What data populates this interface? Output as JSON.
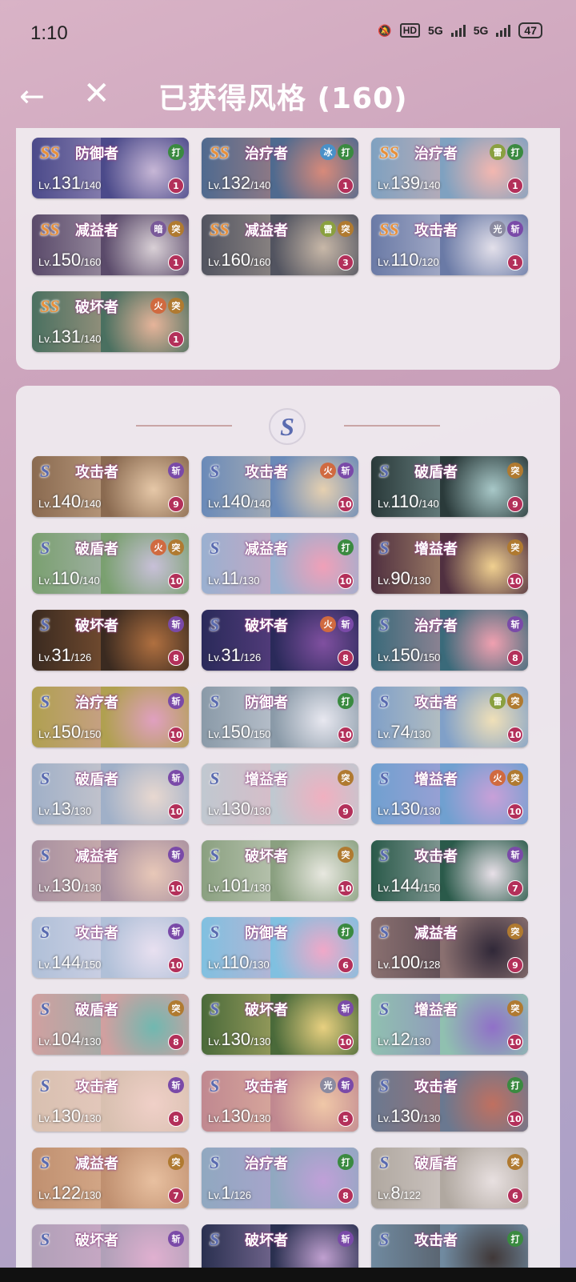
{
  "status": {
    "time": "1:10",
    "hd": "HD",
    "net1": "5G",
    "net2": "5G",
    "battery": "47"
  },
  "header": {
    "title": "已获得风格 (160)"
  },
  "sections": [
    {
      "rank": "SS",
      "cards": [
        {
          "rank": "SS",
          "role": "防御者",
          "el": "",
          "type": "打",
          "lv": "131",
          "max": "140",
          "count": "1",
          "c1": "#4b4a8a",
          "c2": "#c7b7d6"
        },
        {
          "rank": "SS",
          "role": "治疗者",
          "el": "冰",
          "type": "打",
          "lv": "132",
          "max": "140",
          "count": "1",
          "c1": "#4f6a8f",
          "c2": "#d88a7a"
        },
        {
          "rank": "SS",
          "role": "治疗者",
          "el": "雷",
          "type": "打",
          "lv": "139",
          "max": "140",
          "count": "1",
          "c1": "#7fa1c0",
          "c2": "#f3b7b0"
        },
        {
          "rank": "SS",
          "role": "减益者",
          "el": "暗",
          "type": "突",
          "lv": "150",
          "max": "160",
          "count": "1",
          "c1": "#5a4a6a",
          "c2": "#d9d0d6"
        },
        {
          "rank": "SS",
          "role": "减益者",
          "el": "雷",
          "type": "突",
          "lv": "160",
          "max": "160",
          "count": "3",
          "c1": "#525460",
          "c2": "#c8b8a8"
        },
        {
          "rank": "SS",
          "role": "攻击者",
          "el": "光",
          "type": "斩",
          "lv": "110",
          "max": "120",
          "count": "1",
          "c1": "#6a7aa6",
          "c2": "#e3e0ea"
        },
        {
          "rank": "SS",
          "role": "破坏者",
          "el": "火",
          "type": "突",
          "lv": "131",
          "max": "140",
          "count": "1",
          "c1": "#4a7060",
          "c2": "#e6b49a"
        }
      ]
    },
    {
      "rank": "S",
      "cards": [
        {
          "rank": "S",
          "role": "攻击者",
          "el": "",
          "type": "斩",
          "lv": "140",
          "max": "140",
          "count": "9",
          "c1": "#8a6a50",
          "c2": "#e6c8a8"
        },
        {
          "rank": "S",
          "role": "攻击者",
          "el": "火",
          "type": "斩",
          "lv": "140",
          "max": "140",
          "count": "10",
          "c1": "#6a8ab8",
          "c2": "#e6d0b0"
        },
        {
          "rank": "S",
          "role": "破盾者",
          "el": "",
          "type": "突",
          "lv": "110",
          "max": "140",
          "count": "9",
          "c1": "#2a3a3a",
          "c2": "#a8c8c8"
        },
        {
          "rank": "S",
          "role": "破盾者",
          "el": "火",
          "type": "突",
          "lv": "110",
          "max": "140",
          "count": "10",
          "c1": "#7aa070",
          "c2": "#c8c0d8"
        },
        {
          "rank": "S",
          "role": "减益者",
          "el": "",
          "type": "打",
          "lv": "11",
          "max": "130",
          "count": "10",
          "c1": "#9ab0d0",
          "c2": "#f0a0b8"
        },
        {
          "rank": "S",
          "role": "增益者",
          "el": "",
          "type": "突",
          "lv": "90",
          "max": "130",
          "count": "10",
          "c1": "#503040",
          "c2": "#f0d090"
        },
        {
          "rank": "S",
          "role": "破坏者",
          "el": "",
          "type": "斩",
          "lv": "31",
          "max": "126",
          "count": "8",
          "c1": "#3a2a20",
          "c2": "#b07040"
        },
        {
          "rank": "S",
          "role": "破坏者",
          "el": "火",
          "type": "斩",
          "lv": "31",
          "max": "126",
          "count": "8",
          "c1": "#2a2a5a",
          "c2": "#8050a0"
        },
        {
          "rank": "S",
          "role": "治疗者",
          "el": "",
          "type": "斩",
          "lv": "150",
          "max": "150",
          "count": "8",
          "c1": "#3a6a7a",
          "c2": "#f0a0b0"
        },
        {
          "rank": "S",
          "role": "治疗者",
          "el": "",
          "type": "斩",
          "lv": "150",
          "max": "150",
          "count": "10",
          "c1": "#b0a050",
          "c2": "#e0a0c0"
        },
        {
          "rank": "S",
          "role": "防御者",
          "el": "",
          "type": "打",
          "lv": "150",
          "max": "150",
          "count": "10",
          "c1": "#8a9aa8",
          "c2": "#e8e8f0"
        },
        {
          "rank": "S",
          "role": "攻击者",
          "el": "雷",
          "type": "突",
          "lv": "74",
          "max": "130",
          "count": "10",
          "c1": "#80a0c8",
          "c2": "#f0e0b8"
        },
        {
          "rank": "S",
          "role": "破盾者",
          "el": "",
          "type": "斩",
          "lv": "13",
          "max": "130",
          "count": "10",
          "c1": "#a0b0c8",
          "c2": "#e8d8d0"
        },
        {
          "rank": "S",
          "role": "增益者",
          "el": "",
          "type": "突",
          "lv": "130",
          "max": "130",
          "count": "9",
          "c1": "#c0c8d0",
          "c2": "#f0b0c0"
        },
        {
          "rank": "S",
          "role": "增益者",
          "el": "火",
          "type": "突",
          "lv": "130",
          "max": "130",
          "count": "10",
          "c1": "#70a0d0",
          "c2": "#c8a0d8"
        },
        {
          "rank": "S",
          "role": "减益者",
          "el": "",
          "type": "斩",
          "lv": "130",
          "max": "130",
          "count": "10",
          "c1": "#a890a0",
          "c2": "#e8c8b8"
        },
        {
          "rank": "S",
          "role": "破坏者",
          "el": "",
          "type": "突",
          "lv": "101",
          "max": "130",
          "count": "10",
          "c1": "#8aa080",
          "c2": "#e8e8e0"
        },
        {
          "rank": "S",
          "role": "攻击者",
          "el": "",
          "type": "斩",
          "lv": "144",
          "max": "150",
          "count": "7",
          "c1": "#2a5a4a",
          "c2": "#e8e0e8"
        },
        {
          "rank": "S",
          "role": "攻击者",
          "el": "",
          "type": "斩",
          "lv": "144",
          "max": "150",
          "count": "10",
          "c1": "#b0c0d8",
          "c2": "#e8e0f0"
        },
        {
          "rank": "S",
          "role": "防御者",
          "el": "",
          "type": "打",
          "lv": "110",
          "max": "130",
          "count": "6",
          "c1": "#80c0e0",
          "c2": "#f0a8c8"
        },
        {
          "rank": "S",
          "role": "减益者",
          "el": "",
          "type": "突",
          "lv": "100",
          "max": "128",
          "count": "9",
          "c1": "#8a7070",
          "c2": "#302838"
        },
        {
          "rank": "S",
          "role": "破盾者",
          "el": "",
          "type": "突",
          "lv": "104",
          "max": "130",
          "count": "8",
          "c1": "#d0a0a0",
          "c2": "#70b8b0"
        },
        {
          "rank": "S",
          "role": "破坏者",
          "el": "",
          "type": "斩",
          "lv": "130",
          "max": "130",
          "count": "10",
          "c1": "#4a6a3a",
          "c2": "#e8d080"
        },
        {
          "rank": "S",
          "role": "增益者",
          "el": "",
          "type": "突",
          "lv": "12",
          "max": "130",
          "count": "10",
          "c1": "#90c0b0",
          "c2": "#9070c8"
        },
        {
          "rank": "S",
          "role": "攻击者",
          "el": "",
          "type": "斩",
          "lv": "130",
          "max": "130",
          "count": "8",
          "c1": "#d8c0b0",
          "c2": "#f0d0c8"
        },
        {
          "rank": "S",
          "role": "攻击者",
          "el": "光",
          "type": "斩",
          "lv": "130",
          "max": "130",
          "count": "5",
          "c1": "#c08890",
          "c2": "#f0c8a8"
        },
        {
          "rank": "S",
          "role": "攻击者",
          "el": "",
          "type": "打",
          "lv": "130",
          "max": "130",
          "count": "10",
          "c1": "#6a7890",
          "c2": "#c07060"
        },
        {
          "rank": "S",
          "role": "减益者",
          "el": "",
          "type": "突",
          "lv": "122",
          "max": "130",
          "count": "7",
          "c1": "#c09070",
          "c2": "#e8c0a0"
        },
        {
          "rank": "S",
          "role": "治疗者",
          "el": "",
          "type": "打",
          "lv": "1",
          "max": "126",
          "count": "8",
          "c1": "#90a8c0",
          "c2": "#c0a0d8"
        },
        {
          "rank": "S",
          "role": "破盾者",
          "el": "",
          "type": "突",
          "lv": "8",
          "max": "122",
          "count": "6",
          "c1": "#b0a8a0",
          "c2": "#e8e0e0"
        },
        {
          "rank": "S",
          "role": "破坏者",
          "el": "",
          "type": "斩",
          "lv": "",
          "max": "",
          "count": "",
          "c1": "#b0a0b8",
          "c2": "#e0b0d0"
        },
        {
          "rank": "S",
          "role": "破坏者",
          "el": "",
          "type": "斩",
          "lv": "",
          "max": "",
          "count": "",
          "c1": "#2a3050",
          "c2": "#c0a0d0"
        },
        {
          "rank": "S",
          "role": "攻击者",
          "el": "",
          "type": "打",
          "lv": "",
          "max": "",
          "count": "",
          "c1": "#708aa0",
          "c2": "#403838"
        }
      ]
    }
  ],
  "lv_prefix": "Lv.",
  "colors": {
    "ss": "#e8903a",
    "s": "#5a6bb0"
  }
}
